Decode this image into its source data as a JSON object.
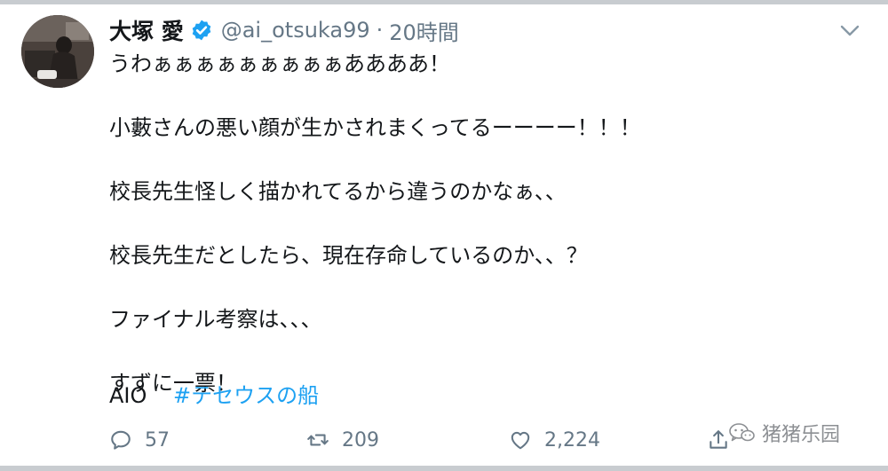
{
  "tweet": {
    "display_name": "大塚 愛",
    "handle": "@ai_otsuka99",
    "separator": "·",
    "time": "20時間",
    "lines": [
      "うわぁぁぁぁぁぁぁぁぁああああ！",
      "",
      "小藪さんの悪い顔が生かされまくってるーーーー！！！",
      "",
      "校長先生怪しく描かれてるから違うのかなぁ、、",
      "",
      "校長先生だとしたら、現在存命しているのか、、？",
      "",
      "ファイナル考察は、、、",
      "",
      "すずに一票！"
    ],
    "tag_text": "AIO",
    "hashtag": "#テセウスの船"
  },
  "actions": {
    "reply_count": "57",
    "retweet_count": "209",
    "like_count": "2,224"
  },
  "watermark": {
    "text": "猪猪乐园"
  },
  "colors": {
    "accent": "#1da1f2",
    "secondary_text": "#657786",
    "primary_text": "#14171a"
  },
  "icons": {
    "verified": "verified-badge-icon",
    "menu": "chevron-down-icon",
    "reply": "reply-icon",
    "retweet": "retweet-icon",
    "like": "heart-icon",
    "share": "share-icon",
    "watermark": "wechat-icon"
  }
}
